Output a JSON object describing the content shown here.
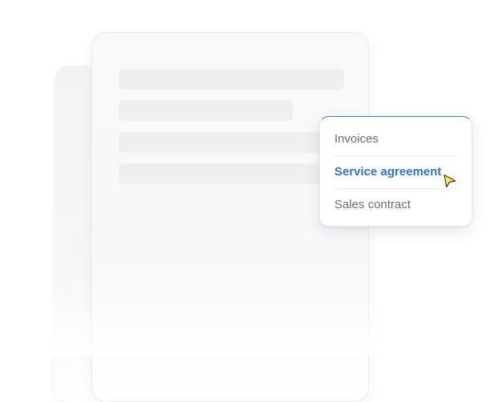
{
  "menu": {
    "items": [
      {
        "label": "Invoices",
        "active": false
      },
      {
        "label": "Service agreement",
        "active": true
      },
      {
        "label": "Sales contract",
        "active": false
      }
    ]
  },
  "colors": {
    "accent": "#2f74d0",
    "menu_text": "#6b6e75",
    "dropdown_top_border": "#3d7fd6",
    "cursor_fill": "#f5ee55",
    "placeholder": "#efeff0"
  },
  "icons": {
    "cursor": "mouse-pointer-icon"
  }
}
